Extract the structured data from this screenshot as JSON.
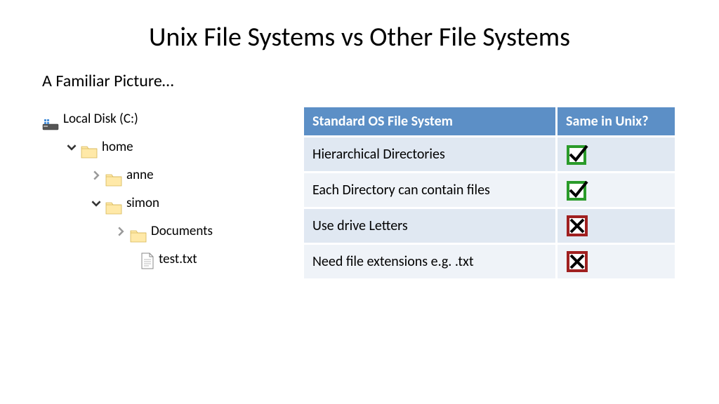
{
  "title": "Unix File Systems vs Other File Systems",
  "subtitle": "A Familiar Picture…",
  "tree": {
    "root": "Local Disk (C:)",
    "home": "home",
    "anne": "anne",
    "simon": "simon",
    "documents": "Documents",
    "testfile": "test.txt"
  },
  "table": {
    "headers": {
      "col1": "Standard OS File System",
      "col2": "Same in Unix?"
    },
    "rows": [
      {
        "feature": "Hierarchical Directories",
        "same": true
      },
      {
        "feature": "Each Directory can contain files",
        "same": true
      },
      {
        "feature": "Use drive Letters",
        "same": false
      },
      {
        "feature": "Need file extensions e.g. .txt",
        "same": false
      }
    ]
  }
}
